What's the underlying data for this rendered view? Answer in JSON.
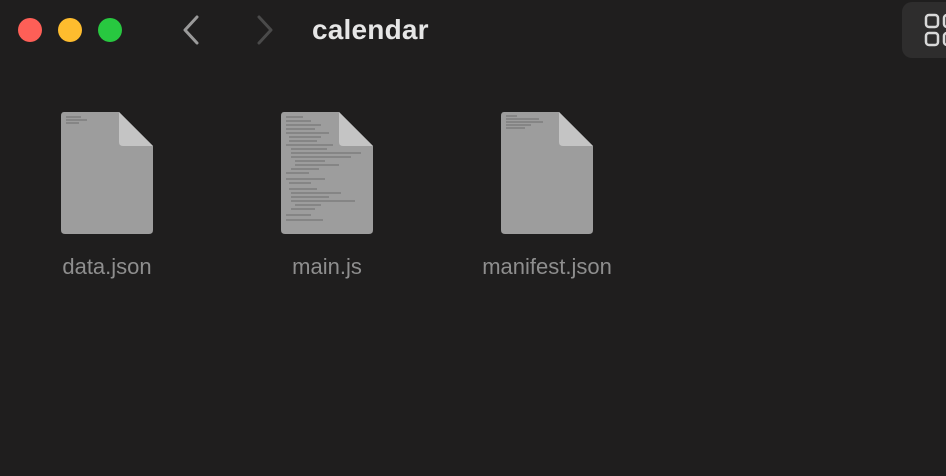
{
  "window": {
    "title": "calendar"
  },
  "toolbar": {
    "back_icon": "chevron-left-icon",
    "forward_icon": "chevron-right-icon",
    "view_icon": "grid-view-icon"
  },
  "files": [
    {
      "name": "data.json",
      "icon": "document-icon"
    },
    {
      "name": "main.js",
      "icon": "document-icon"
    },
    {
      "name": "manifest.json",
      "icon": "document-icon"
    }
  ],
  "colors": {
    "background": "#1f1e1e",
    "close": "#fe5f57",
    "minimize": "#febc2e",
    "maximize": "#28c840",
    "title": "#e6e6e6",
    "file_label": "#8e8e8e",
    "document": "#9d9d9d"
  }
}
